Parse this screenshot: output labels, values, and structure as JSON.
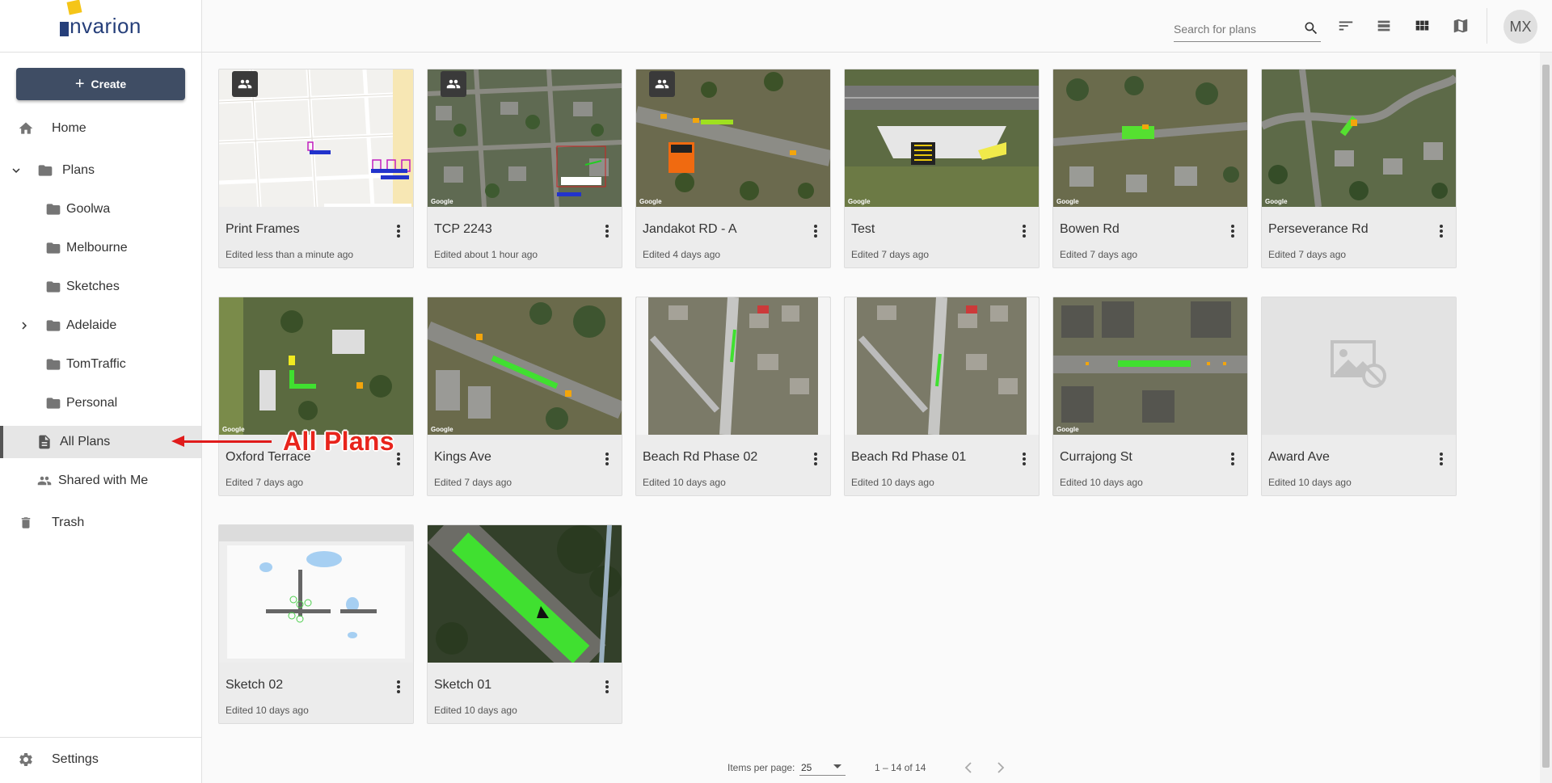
{
  "brand": {
    "name": "nvarion"
  },
  "sidebar": {
    "create_label": "Create",
    "home_label": "Home",
    "plans_label": "Plans",
    "folders": [
      "Goolwa",
      "Melbourne",
      "Sketches",
      "Adelaide",
      "TomTraffic",
      "Personal"
    ],
    "all_plans_label": "All Plans",
    "shared_label": "Shared with Me",
    "trash_label": "Trash",
    "settings_label": "Settings"
  },
  "topbar": {
    "search_placeholder": "Search for plans",
    "avatar_initials": "MX"
  },
  "plans": [
    {
      "title": "Print Frames",
      "edited": "Edited less than a minute ago",
      "shared": true,
      "thumb": "map-light"
    },
    {
      "title": "TCP 2243",
      "edited": "Edited about 1 hour ago",
      "shared": true,
      "thumb": "aerial"
    },
    {
      "title": "Jandakot RD - A",
      "edited": "Edited 4 days ago",
      "shared": true,
      "thumb": "aerial"
    },
    {
      "title": "Test",
      "edited": "Edited 7 days ago",
      "shared": false,
      "thumb": "aerial"
    },
    {
      "title": "Bowen Rd",
      "edited": "Edited 7 days ago",
      "shared": false,
      "thumb": "aerial"
    },
    {
      "title": "Perseverance Rd",
      "edited": "Edited 7 days ago",
      "shared": false,
      "thumb": "aerial"
    },
    {
      "title": "Oxford Terrace",
      "edited": "Edited 7 days ago",
      "shared": false,
      "thumb": "aerial"
    },
    {
      "title": "Kings Ave",
      "edited": "Edited 7 days ago",
      "shared": false,
      "thumb": "aerial"
    },
    {
      "title": "Beach Rd Phase 02",
      "edited": "Edited 10 days ago",
      "shared": false,
      "thumb": "aerial"
    },
    {
      "title": "Beach Rd Phase 01",
      "edited": "Edited 10 days ago",
      "shared": false,
      "thumb": "aerial"
    },
    {
      "title": "Currajong St",
      "edited": "Edited 10 days ago",
      "shared": false,
      "thumb": "aerial"
    },
    {
      "title": "Award Ave",
      "edited": "Edited 10 days ago",
      "shared": false,
      "thumb": "placeholder"
    },
    {
      "title": "Sketch 02",
      "edited": "Edited 10 days ago",
      "shared": false,
      "thumb": "map-light"
    },
    {
      "title": "Sketch 01",
      "edited": "Edited 10 days ago",
      "shared": false,
      "thumb": "aerial"
    }
  ],
  "pager": {
    "items_per_page_label": "Items per page:",
    "page_size": "25",
    "range": "1 – 14 of 14"
  },
  "annotation": {
    "text": "All Plans"
  },
  "colors": {
    "accent": "#3f4d64",
    "annotation": "#e8241c",
    "brand": "#263f7a"
  }
}
